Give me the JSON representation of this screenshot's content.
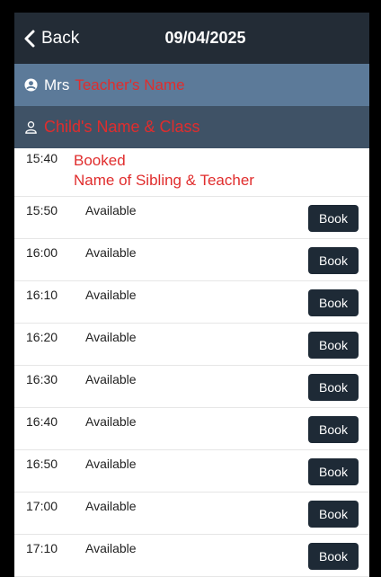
{
  "nav": {
    "back_label": "Back",
    "date": "09/04/2025"
  },
  "teacher": {
    "title": "Mrs",
    "name": "Teacher's Name"
  },
  "child": {
    "name_class": "Child's Name & Class"
  },
  "booked": {
    "time": "15:40",
    "status": "Booked",
    "detail": "Name of Sibling & Teacher"
  },
  "slots": [
    {
      "time": "15:50",
      "status": "Available",
      "action": "Book"
    },
    {
      "time": "16:00",
      "status": "Available",
      "action": "Book"
    },
    {
      "time": "16:10",
      "status": "Available",
      "action": "Book"
    },
    {
      "time": "16:20",
      "status": "Available",
      "action": "Book"
    },
    {
      "time": "16:30",
      "status": "Available",
      "action": "Book"
    },
    {
      "time": "16:40",
      "status": "Available",
      "action": "Book"
    },
    {
      "time": "16:50",
      "status": "Available",
      "action": "Book"
    },
    {
      "time": "17:00",
      "status": "Available",
      "action": "Book"
    },
    {
      "time": "17:10",
      "status": "Available",
      "action": "Book"
    }
  ],
  "colors": {
    "navbar": "#232c36",
    "teacher_bar": "#5c7a99",
    "child_bar": "#3f5266",
    "highlight_red": "#e02d2d",
    "button": "#1e2a36"
  }
}
